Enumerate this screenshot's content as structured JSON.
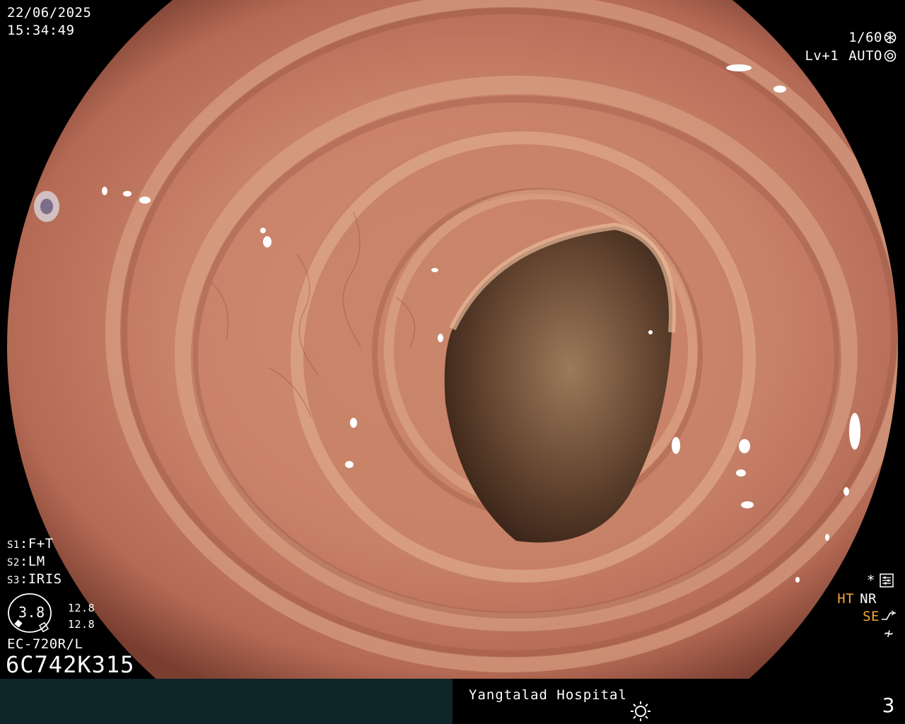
{
  "header": {
    "date": "22/06/2025",
    "time": "15:34:49"
  },
  "exposure": {
    "shutter": "1/60",
    "shutter_icon": "aperture-icon",
    "level": "Lv+1",
    "mode": "AUTO",
    "mode_icon": "iris-icon"
  },
  "scope_settings": {
    "s1": {
      "key": "S1",
      "value": "F+T"
    },
    "s2": {
      "key": "S2",
      "value": "LM"
    },
    "s3": {
      "key": "S3",
      "value": "IRIS"
    }
  },
  "zoom": {
    "value": "3.8",
    "top": "12.8",
    "bottom": "12.8"
  },
  "scope": {
    "model": "EC-720R/L",
    "serial": "6C742K315"
  },
  "enhancement": {
    "star": "*",
    "ht": "HT",
    "nr": "NR",
    "se": "SE",
    "fx": "≁"
  },
  "footer": {
    "hospital": "Yangtalad Hospital",
    "count": "3",
    "icon": "sun-icon"
  },
  "colors": {
    "accent_orange": "#f2a83c",
    "footer_bg": "#0d2428",
    "mucosa": "#c27a60"
  }
}
